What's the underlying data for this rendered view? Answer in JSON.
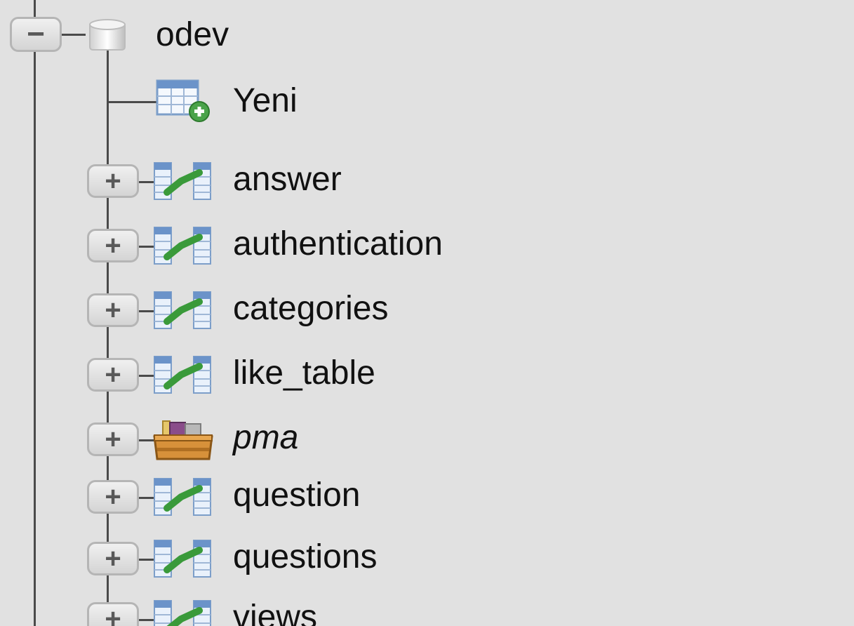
{
  "database": {
    "name": "odev",
    "expanded": true,
    "new_item_label": "Yeni"
  },
  "tables": [
    {
      "label": "answer",
      "icon": "table-icon",
      "italic": false
    },
    {
      "label": "authentication",
      "icon": "table-icon",
      "italic": false
    },
    {
      "label": "categories",
      "icon": "table-icon",
      "italic": false
    },
    {
      "label": "like_table",
      "icon": "table-icon",
      "italic": false
    },
    {
      "label": "pma",
      "icon": "package-icon",
      "italic": true
    },
    {
      "label": "question",
      "icon": "table-icon",
      "italic": false
    },
    {
      "label": "questions",
      "icon": "table-icon",
      "italic": false
    },
    {
      "label": "views",
      "icon": "table-icon",
      "italic": false
    }
  ],
  "toggle_glyphs": {
    "collapse": "−",
    "expand": "+"
  },
  "colors": {
    "background": "#e1e1e1",
    "tree_line": "#4a4a4a",
    "text": "#111111",
    "table_icon_green": "#3a9a3a",
    "table_icon_blue": "#5a8fd0"
  }
}
